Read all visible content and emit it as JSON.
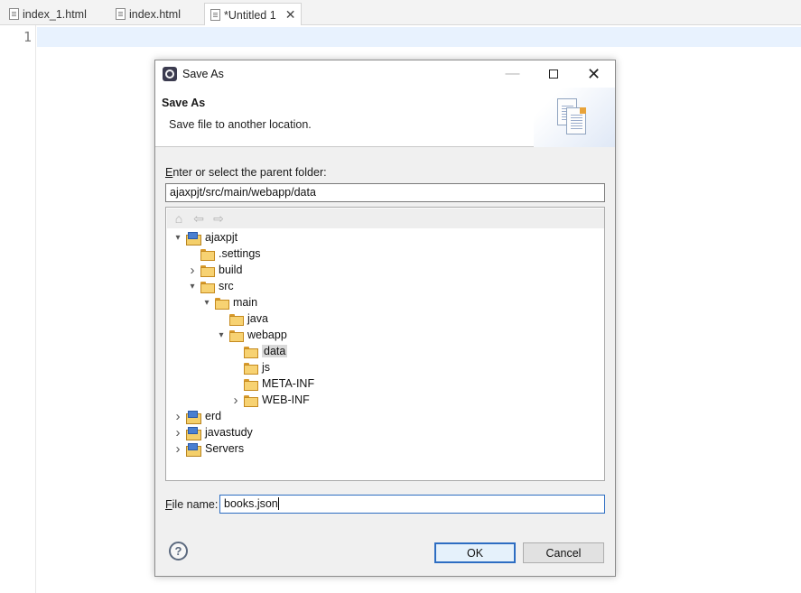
{
  "editor": {
    "tabs": [
      {
        "label": "index_1.html"
      },
      {
        "label": "index.html"
      },
      {
        "label": "*Untitled 1"
      }
    ],
    "line_number": "1"
  },
  "dialog": {
    "title": "Save As",
    "header_title": "Save As",
    "header_desc": "Save file to another location.",
    "folder_label_accel": "E",
    "folder_label_rest": "nter or select the parent folder:",
    "folder_value": "ajaxpjt/src/main/webapp/data",
    "tree": [
      {
        "label": "ajaxpjt",
        "depth": 0,
        "expand": "open",
        "icon": "project-icon"
      },
      {
        "label": ".settings",
        "depth": 1,
        "expand": "none",
        "icon": "folder-icon"
      },
      {
        "label": "build",
        "depth": 1,
        "expand": "closed",
        "icon": "folder-icon"
      },
      {
        "label": "src",
        "depth": 1,
        "expand": "open",
        "icon": "folder-icon"
      },
      {
        "label": "main",
        "depth": 2,
        "expand": "open",
        "icon": "folder-icon"
      },
      {
        "label": "java",
        "depth": 3,
        "expand": "none",
        "icon": "folder-icon"
      },
      {
        "label": "webapp",
        "depth": 3,
        "expand": "open",
        "icon": "folder-icon"
      },
      {
        "label": "data",
        "depth": 4,
        "expand": "none",
        "icon": "folder-icon",
        "selected": true
      },
      {
        "label": "js",
        "depth": 4,
        "expand": "none",
        "icon": "folder-icon"
      },
      {
        "label": "META-INF",
        "depth": 4,
        "expand": "none",
        "icon": "folder-icon"
      },
      {
        "label": "WEB-INF",
        "depth": 4,
        "expand": "closed",
        "icon": "folder-icon"
      },
      {
        "label": "erd",
        "depth": 0,
        "expand": "closed",
        "icon": "project-icon"
      },
      {
        "label": "javastudy",
        "depth": 0,
        "expand": "closed",
        "icon": "project-icon"
      },
      {
        "label": "Servers",
        "depth": 0,
        "expand": "closed",
        "icon": "project-icon"
      }
    ],
    "filename_label_accel": "F",
    "filename_label_rest": "ile name:",
    "filename_value": "books.json",
    "ok_label": "OK",
    "cancel_label": "Cancel",
    "help_label": "?"
  }
}
